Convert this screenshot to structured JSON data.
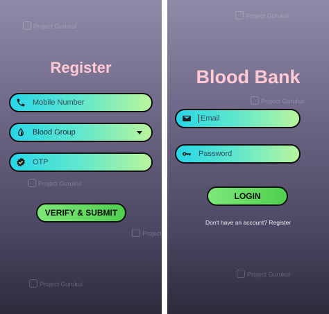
{
  "watermark": {
    "brand_prefix": "Project",
    "brand_suffix": "Gurukul"
  },
  "register_screen": {
    "title": "Register",
    "mobile_placeholder": "Mobile Number",
    "blood_group_value": "Blood Group",
    "otp_placeholder": "OTP",
    "verify_label": "VERIFY & SUBMIT"
  },
  "login_screen": {
    "title": "Blood Bank",
    "email_placeholder": "Email",
    "password_placeholder": "Password",
    "login_label": "LOGIN",
    "register_prompt": "Don't have an account? Register"
  },
  "icons": {
    "mobile": "phone-icon",
    "blood_group": "blood-drop-icon",
    "otp": "verified-badge-icon",
    "dropdown": "caret-down-icon",
    "email": "envelope-icon",
    "password": "key-icon",
    "watermark": "project-gurukul-logo-icon"
  },
  "colors": {
    "title": "#ffc9d4",
    "field_start": "#27d6e8",
    "field_end": "#b9f59c",
    "button_start": "#7ee87a",
    "button_end": "#4fcf4f",
    "border": "#111111"
  }
}
